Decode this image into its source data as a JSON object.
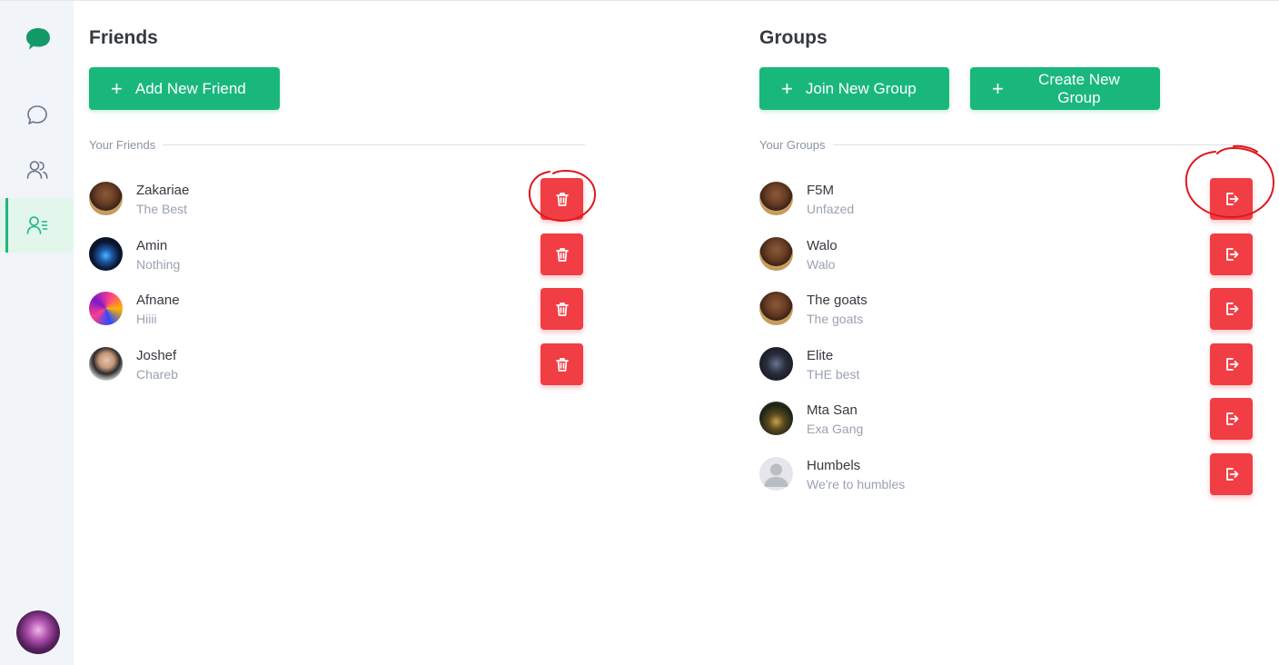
{
  "sidebar": {
    "nav": [
      {
        "name": "chats",
        "icon": "chat-bubble-icon",
        "active": false
      },
      {
        "name": "contacts",
        "icon": "users-icon",
        "active": false
      },
      {
        "name": "friends-list",
        "icon": "user-list-icon",
        "active": true
      }
    ],
    "user_avatar": "user-avatar"
  },
  "friends": {
    "title": "Friends",
    "add_button": "Add New Friend",
    "section_label": "Your Friends",
    "items": [
      {
        "name": "Zakariae",
        "status": "The Best"
      },
      {
        "name": "Amin",
        "status": "Nothing"
      },
      {
        "name": "Afnane",
        "status": "Hiiii"
      },
      {
        "name": "Joshef",
        "status": "Chareb"
      }
    ],
    "action_icon": "trash-icon"
  },
  "groups": {
    "title": "Groups",
    "join_button": "Join New Group",
    "create_button": "Create New Group",
    "section_label": "Your Groups",
    "items": [
      {
        "name": "F5M",
        "status": "Unfazed"
      },
      {
        "name": "Walo",
        "status": "Walo"
      },
      {
        "name": "The goats",
        "status": "The goats"
      },
      {
        "name": "Elite",
        "status": "THE best"
      },
      {
        "name": "Mta San",
        "status": "Exa Gang"
      },
      {
        "name": "Humbels",
        "status": "We're to humbles"
      }
    ],
    "action_icon": "leave-icon"
  },
  "colors": {
    "accent": "#1ab77d",
    "danger": "#f03e44",
    "sidebar_bg": "#f1f4f9",
    "annotation": "#e0161c"
  }
}
